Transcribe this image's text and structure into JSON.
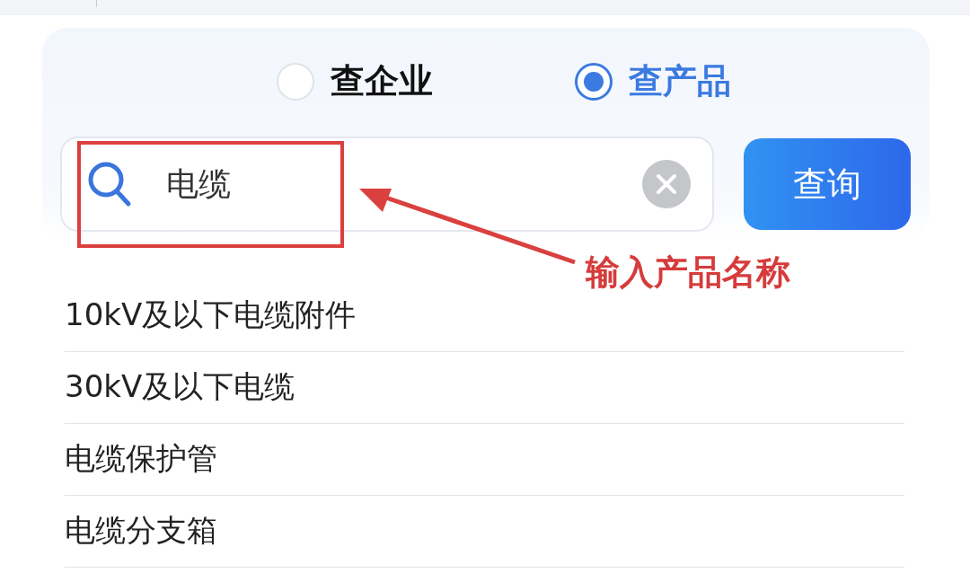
{
  "radios": [
    {
      "label": "查企业",
      "selected": false
    },
    {
      "label": "查产品",
      "selected": true
    }
  ],
  "search": {
    "value": "电缆"
  },
  "query_button": "查询",
  "annotation": {
    "label": "输入产品名称"
  },
  "suggestions": [
    "10kV及以下电缆附件",
    "30kV及以下电缆",
    "电缆保护管",
    "电缆分支箱"
  ]
}
